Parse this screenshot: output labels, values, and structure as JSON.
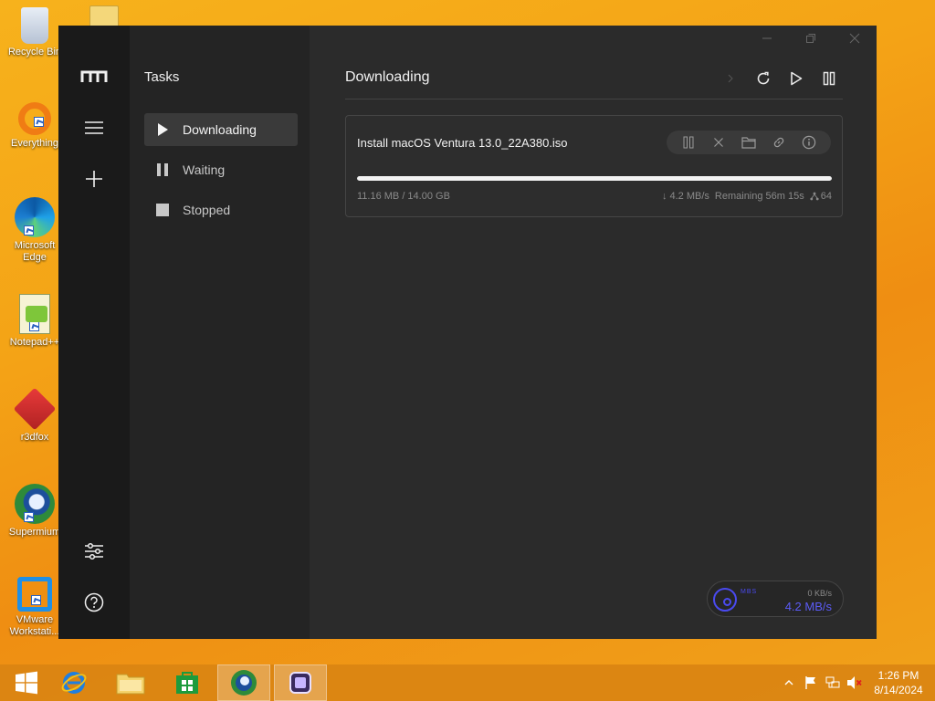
{
  "desktop": {
    "icons": [
      {
        "label": "Recycle Bin",
        "icon": "recycle-bin-icon"
      },
      {
        "label": "Everything",
        "icon": "everything-icon"
      },
      {
        "label": "Microsoft Edge",
        "icon": "edge-icon"
      },
      {
        "label": "Notepad++",
        "icon": "notepad-plus-plus-icon"
      },
      {
        "label": "r3dfox",
        "icon": "r3dfox-icon"
      },
      {
        "label": "Supermium",
        "icon": "supermium-icon"
      },
      {
        "label": "VMware Workstati...",
        "icon": "vmware-icon"
      }
    ]
  },
  "app": {
    "sidebar_panel": {
      "title": "Tasks",
      "items": [
        {
          "label": "Downloading",
          "icon": "play-icon",
          "active": true
        },
        {
          "label": "Waiting",
          "icon": "pause-icon",
          "active": false
        },
        {
          "label": "Stopped",
          "icon": "stop-icon",
          "active": false
        }
      ]
    },
    "main": {
      "title": "Downloading",
      "task": {
        "file_name": "Install macOS Ventura 13.0_22A380.iso",
        "progress_fraction": 0.0008,
        "size_text": "11.16 MB / 14.00 GB",
        "speed": "↓ 4.2 MB/s",
        "remaining": "Remaining 56m 15s",
        "connections": "64"
      }
    },
    "speedometer": {
      "badge": "MBS",
      "upload": "0 KB/s",
      "download": "4.2 MB/s"
    },
    "colors": {
      "accent": "#5b5bf5",
      "rail": "#1a1a1a",
      "panel": "#242424",
      "main": "#2b2b2b"
    }
  },
  "taskbar": {
    "time": "1:26 PM",
    "date": "8/14/2024"
  }
}
